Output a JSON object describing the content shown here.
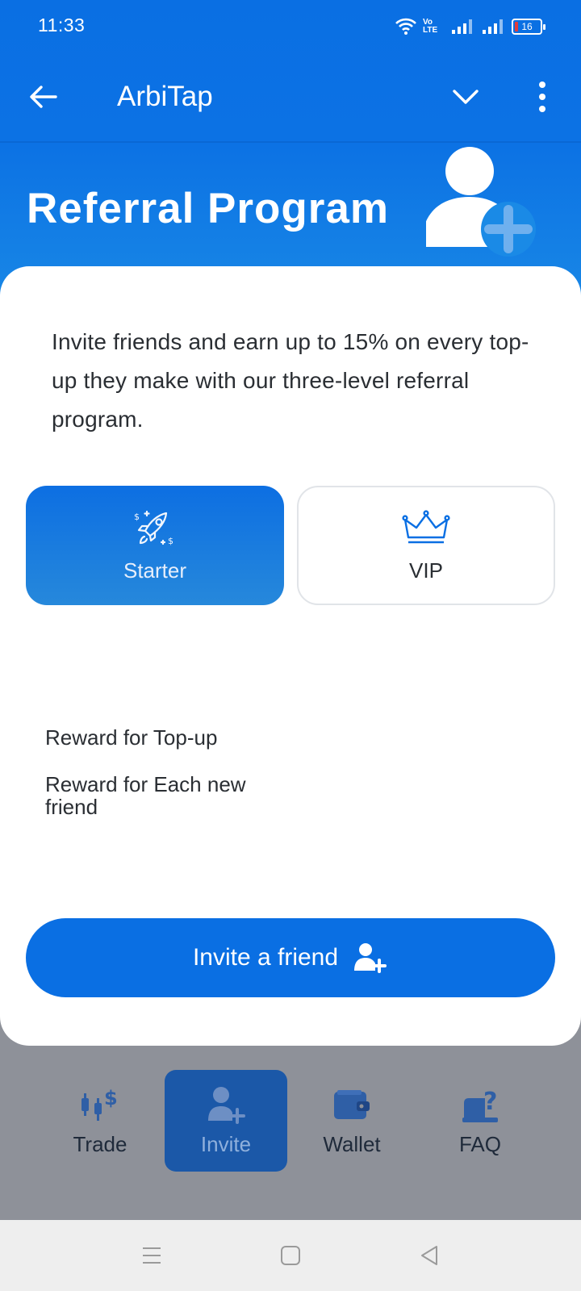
{
  "status": {
    "time": "11:33",
    "network": "Vo LTE",
    "battery": "16"
  },
  "appbar": {
    "title": "ArbiTap"
  },
  "hero": {
    "title": "Referral Program"
  },
  "intro": {
    "text": "Invite friends and earn up to 15% on every top-up they make with our three-level referral program."
  },
  "plans": [
    {
      "label": "Starter",
      "icon": "rocket-icon",
      "selected": true
    },
    {
      "label": "VIP",
      "icon": "crown-icon",
      "selected": false
    }
  ],
  "rewards": [
    {
      "label": "Reward for Top-up"
    },
    {
      "label": "Reward for Each new friend"
    }
  ],
  "invite_button": {
    "label": "Invite a friend",
    "icon": "add-user-icon"
  },
  "bottom_nav": [
    {
      "label": "Trade",
      "icon": "candlestick-dollar-icon"
    },
    {
      "label": "Invite",
      "icon": "add-user-icon",
      "active": true
    },
    {
      "label": "Wallet",
      "icon": "wallet-icon"
    },
    {
      "label": "FAQ",
      "icon": "faq-icon"
    }
  ],
  "colors": {
    "primary": "#0a6fe3",
    "nav_active": "#1b58a8",
    "overlay": "#8e9199"
  }
}
